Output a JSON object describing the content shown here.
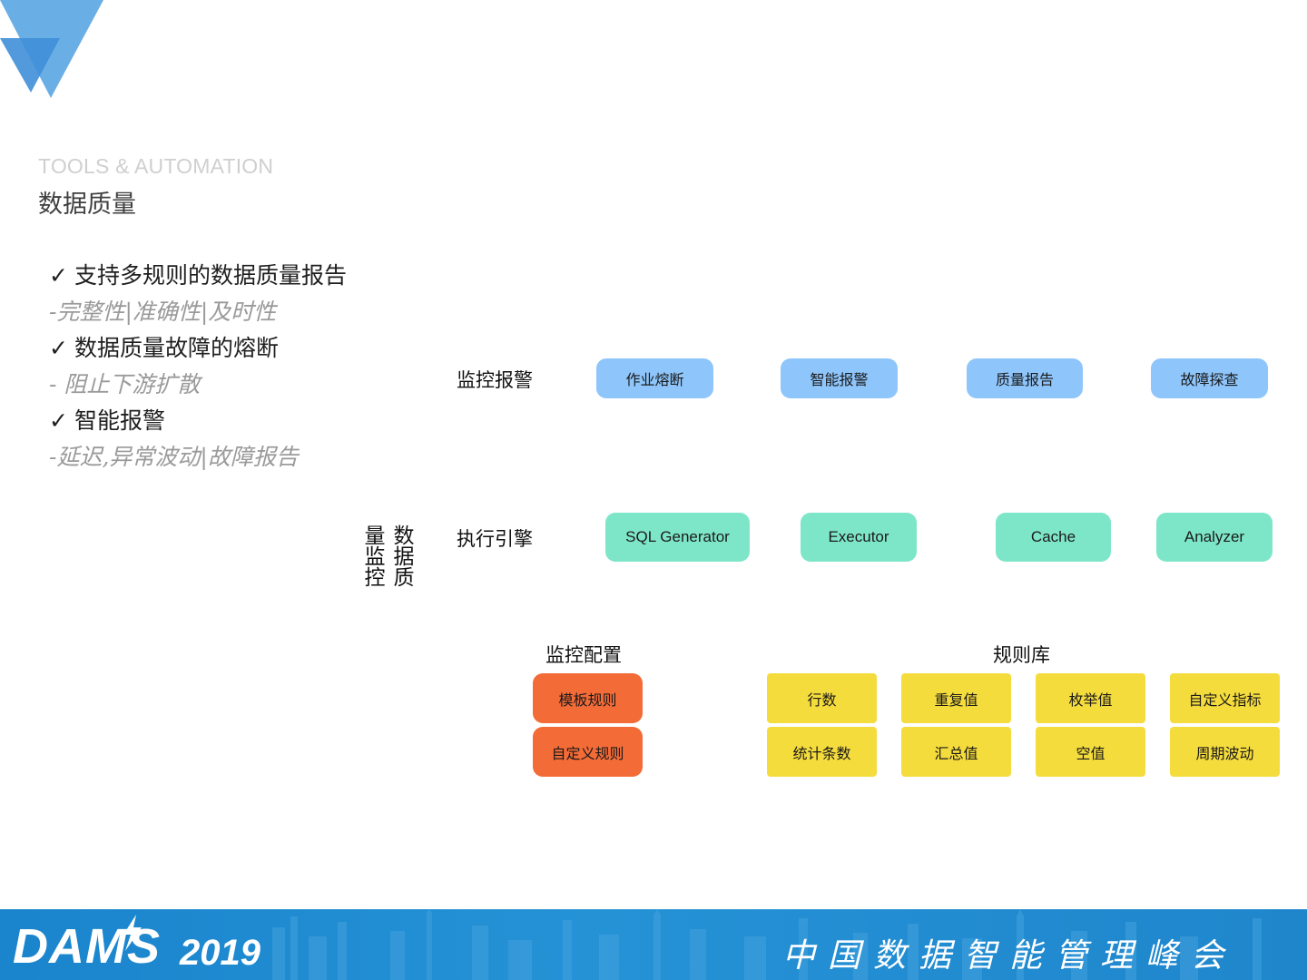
{
  "header": {
    "kicker": "TOOLS & AUTOMATION",
    "title": "数据质量"
  },
  "bullets": [
    {
      "check": "✓",
      "text": "支持多规则的数据质量报告",
      "sub": "-完整性|准确性|及时性"
    },
    {
      "check": "✓",
      "text": "数据质量故障的熔断",
      "sub": "- 阻止下游扩散"
    },
    {
      "check": "✓",
      "text": "智能报警",
      "sub": "-延迟,异常波动|故障报告"
    }
  ],
  "diagram": {
    "vertical_title": "数据质量监控",
    "monitor": {
      "label": "监控报警",
      "items": [
        "作业熔断",
        "智能报警",
        "质量报告",
        "故障探查"
      ]
    },
    "engine": {
      "label": "执行引擎",
      "items": [
        "SQL Generator",
        "Executor",
        "Cache",
        "Analyzer"
      ]
    },
    "config": {
      "label": "监控配置",
      "items": [
        "模板规则",
        "自定义规则"
      ]
    },
    "rules": {
      "label": "规则库",
      "row1": [
        "行数",
        "重复值",
        "枚举值",
        "自定义指标"
      ],
      "row2": [
        "统计条数",
        "汇总值",
        "空值",
        "周期波动"
      ]
    },
    "colors": {
      "monitor": "#8ec5fb",
      "engine": "#7ee6c8",
      "config": "#f36b37",
      "rules": "#f5dc3d"
    }
  },
  "footer": {
    "brand": "DAMS",
    "year": "2019",
    "title": "中国数据智能管理峰会",
    "background": "#1f8ad0"
  }
}
